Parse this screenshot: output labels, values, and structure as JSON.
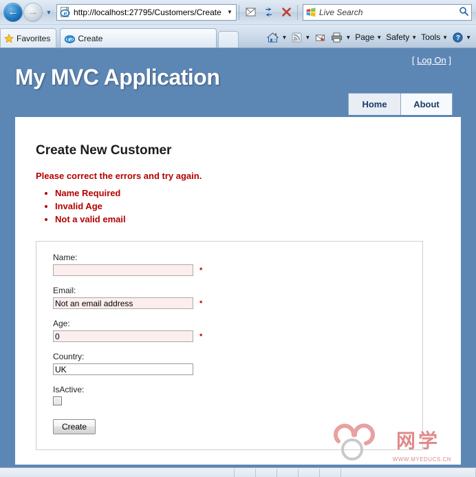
{
  "browser": {
    "url": "http://localhost:27795/Customers/Create",
    "url_dropdown_icon": "chevron-down-icon",
    "back_icon": "back-arrow-icon",
    "forward_icon": "forward-arrow-icon",
    "recent_pages_icon": "chevron-down-icon",
    "compatibility_icon": "compatibility-view-icon",
    "refresh_icon": "refresh-icon",
    "stop_icon": "stop-icon",
    "search": {
      "placeholder": "Live Search",
      "value": "",
      "provider_icon": "windows-logo-icon",
      "go_icon": "search-icon"
    },
    "favorites_label": "Favorites",
    "favorites_icon": "star-icon",
    "tab": {
      "label": "Create",
      "icon": "ie-logo-icon"
    },
    "new_tab_label": "",
    "command_bar": [
      {
        "label": "",
        "icon": "home-icon",
        "has_caret": true
      },
      {
        "label": "",
        "icon": "rss-feeds-icon",
        "has_caret": true
      },
      {
        "label": "",
        "icon": "read-mail-icon",
        "has_caret": false
      },
      {
        "label": "",
        "icon": "print-icon",
        "has_caret": true
      },
      {
        "label": "Page",
        "icon": "",
        "has_caret": true
      },
      {
        "label": "Safety",
        "icon": "",
        "has_caret": true
      },
      {
        "label": "Tools",
        "icon": "",
        "has_caret": true
      },
      {
        "label": "",
        "icon": "help-icon",
        "has_caret": true
      }
    ]
  },
  "page": {
    "logon_prefix": "[",
    "logon_label": "Log On",
    "logon_suffix": "]",
    "title": "My MVC Application",
    "menu": [
      {
        "label": "Home"
      },
      {
        "label": "About"
      }
    ],
    "heading": "Create New Customer",
    "validation_summary": {
      "message": "Please correct the errors and try again.",
      "errors": [
        "Name Required",
        "Invalid Age",
        "Not a valid email"
      ]
    },
    "form": {
      "fields": [
        {
          "label": "Name:",
          "value": "",
          "error": true,
          "required_marker": "*",
          "type": "text"
        },
        {
          "label": "Email:",
          "value": "Not an email address",
          "error": true,
          "required_marker": "*",
          "type": "text"
        },
        {
          "label": "Age:",
          "value": "0",
          "error": true,
          "required_marker": "*",
          "type": "text"
        },
        {
          "label": "Country:",
          "value": "UK",
          "error": false,
          "required_marker": "",
          "type": "text"
        },
        {
          "label": "IsActive:",
          "value": "",
          "error": false,
          "required_marker": "",
          "type": "checkbox",
          "checked": false
        }
      ],
      "submit_label": "Create"
    },
    "watermark": {
      "cn_text": "网学",
      "url_text": "WWW.MYEDUCS.CN"
    }
  },
  "colors": {
    "header_blue": "#5c86b4",
    "error_red": "#b30000",
    "menu_text": "#1b3a6b",
    "error_field_bg": "#fdeeee",
    "watermark_pink": "#e08a8a"
  }
}
